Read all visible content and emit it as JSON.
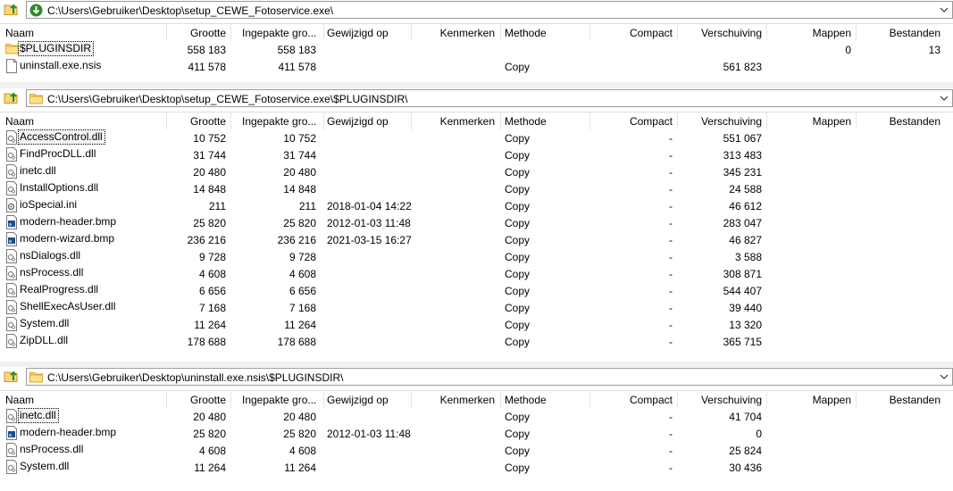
{
  "colors": {
    "separator": "#f0f0f0",
    "border": "#9a9a9a",
    "folder": "#f8d775",
    "arrow_green": "#2f8a2f"
  },
  "columns": [
    "Naam",
    "Grootte",
    "Ingepakte gro...",
    "Gewijzigd op",
    "Kenmerken",
    "Methode",
    "Compact",
    "Verschuiving",
    "Mappen",
    "Bestanden"
  ],
  "panes": [
    {
      "address": "C:\\Users\\Gebruiker\\Desktop\\setup_CEWE_Fotoservice.exe\\",
      "address_icon": "green-down-arrow-icon",
      "rows": [
        {
          "icon": "folder-icon",
          "name": "$PLUGINSDIR",
          "size": "558 183",
          "packed": "558 183",
          "modified": "",
          "attrs": "",
          "method": "",
          "compact": "",
          "offset": "",
          "folders": "0",
          "files": "13"
        },
        {
          "icon": "file-icon",
          "name": "uninstall.exe.nsis",
          "size": "411 578",
          "packed": "411 578",
          "modified": "",
          "attrs": "",
          "method": "Copy",
          "compact": "",
          "offset": "561 823",
          "folders": "",
          "files": ""
        }
      ]
    },
    {
      "address": "C:\\Users\\Gebruiker\\Desktop\\setup_CEWE_Fotoservice.exe\\$PLUGINSDIR\\",
      "address_icon": "folder-icon",
      "rows": [
        {
          "icon": "dll-icon",
          "name": "AccessControl.dll",
          "size": "10 752",
          "packed": "10 752",
          "modified": "",
          "attrs": "",
          "method": "Copy",
          "compact": "-",
          "offset": "551 067",
          "folders": "",
          "files": ""
        },
        {
          "icon": "dll-icon",
          "name": "FindProcDLL.dll",
          "size": "31 744",
          "packed": "31 744",
          "modified": "",
          "attrs": "",
          "method": "Copy",
          "compact": "-",
          "offset": "313 483",
          "folders": "",
          "files": ""
        },
        {
          "icon": "dll-icon",
          "name": "inetc.dll",
          "size": "20 480",
          "packed": "20 480",
          "modified": "",
          "attrs": "",
          "method": "Copy",
          "compact": "-",
          "offset": "345 231",
          "folders": "",
          "files": ""
        },
        {
          "icon": "dll-icon",
          "name": "InstallOptions.dll",
          "size": "14 848",
          "packed": "14 848",
          "modified": "",
          "attrs": "",
          "method": "Copy",
          "compact": "-",
          "offset": "24 588",
          "folders": "",
          "files": ""
        },
        {
          "icon": "ini-icon",
          "name": "ioSpecial.ini",
          "size": "211",
          "packed": "211",
          "modified": "2018-01-04 14:22",
          "attrs": "",
          "method": "Copy",
          "compact": "-",
          "offset": "46 612",
          "folders": "",
          "files": ""
        },
        {
          "icon": "bmp-icon",
          "name": "modern-header.bmp",
          "size": "25 820",
          "packed": "25 820",
          "modified": "2012-01-03 11:48",
          "attrs": "",
          "method": "Copy",
          "compact": "-",
          "offset": "283 047",
          "folders": "",
          "files": ""
        },
        {
          "icon": "bmp-icon",
          "name": "modern-wizard.bmp",
          "size": "236 216",
          "packed": "236 216",
          "modified": "2021-03-15 16:27",
          "attrs": "",
          "method": "Copy",
          "compact": "-",
          "offset": "46 827",
          "folders": "",
          "files": ""
        },
        {
          "icon": "dll-icon",
          "name": "nsDialogs.dll",
          "size": "9 728",
          "packed": "9 728",
          "modified": "",
          "attrs": "",
          "method": "Copy",
          "compact": "-",
          "offset": "3 588",
          "folders": "",
          "files": ""
        },
        {
          "icon": "dll-icon",
          "name": "nsProcess.dll",
          "size": "4 608",
          "packed": "4 608",
          "modified": "",
          "attrs": "",
          "method": "Copy",
          "compact": "-",
          "offset": "308 871",
          "folders": "",
          "files": ""
        },
        {
          "icon": "dll-icon",
          "name": "RealProgress.dll",
          "size": "6 656",
          "packed": "6 656",
          "modified": "",
          "attrs": "",
          "method": "Copy",
          "compact": "-",
          "offset": "544 407",
          "folders": "",
          "files": ""
        },
        {
          "icon": "dll-icon",
          "name": "ShellExecAsUser.dll",
          "size": "7 168",
          "packed": "7 168",
          "modified": "",
          "attrs": "",
          "method": "Copy",
          "compact": "-",
          "offset": "39 440",
          "folders": "",
          "files": ""
        },
        {
          "icon": "dll-icon",
          "name": "System.dll",
          "size": "11 264",
          "packed": "11 264",
          "modified": "",
          "attrs": "",
          "method": "Copy",
          "compact": "-",
          "offset": "13 320",
          "folders": "",
          "files": ""
        },
        {
          "icon": "dll-icon",
          "name": "ZipDLL.dll",
          "size": "178 688",
          "packed": "178 688",
          "modified": "",
          "attrs": "",
          "method": "Copy",
          "compact": "-",
          "offset": "365 715",
          "folders": "",
          "files": ""
        }
      ]
    },
    {
      "address": "C:\\Users\\Gebruiker\\Desktop\\uninstall.exe.nsis\\$PLUGINSDIR\\",
      "address_icon": "folder-icon",
      "rows": [
        {
          "icon": "dll-icon",
          "name": "inetc.dll",
          "size": "20 480",
          "packed": "20 480",
          "modified": "",
          "attrs": "",
          "method": "Copy",
          "compact": "-",
          "offset": "41 704",
          "folders": "",
          "files": ""
        },
        {
          "icon": "bmp-icon",
          "name": "modern-header.bmp",
          "size": "25 820",
          "packed": "25 820",
          "modified": "2012-01-03 11:48",
          "attrs": "",
          "method": "Copy",
          "compact": "-",
          "offset": "0",
          "folders": "",
          "files": ""
        },
        {
          "icon": "dll-icon",
          "name": "nsProcess.dll",
          "size": "4 608",
          "packed": "4 608",
          "modified": "",
          "attrs": "",
          "method": "Copy",
          "compact": "-",
          "offset": "25 824",
          "folders": "",
          "files": ""
        },
        {
          "icon": "dll-icon",
          "name": "System.dll",
          "size": "11 264",
          "packed": "11 264",
          "modified": "",
          "attrs": "",
          "method": "Copy",
          "compact": "-",
          "offset": "30 436",
          "folders": "",
          "files": ""
        }
      ]
    }
  ]
}
